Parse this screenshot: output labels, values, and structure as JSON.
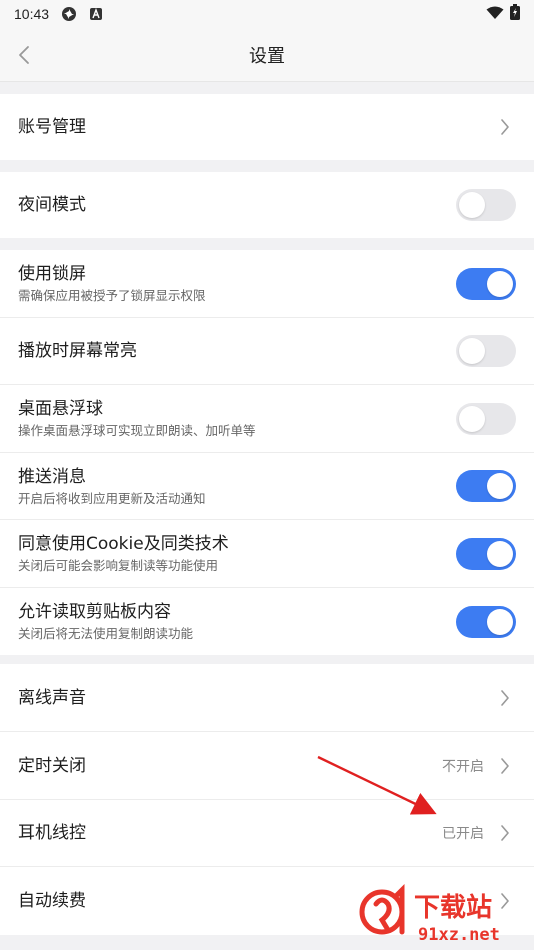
{
  "status_bar": {
    "time": "10:43",
    "icons": [
      "pinwheel-icon",
      "a-badge-icon",
      "wifi-icon",
      "battery-charging-icon"
    ]
  },
  "nav": {
    "title": "设置",
    "back_icon": "chevron-left-icon"
  },
  "sections": [
    {
      "items": [
        {
          "label": "账号管理",
          "control": "chevron"
        }
      ]
    },
    {
      "items": [
        {
          "label": "夜间模式",
          "control": "toggle",
          "on": false
        }
      ]
    },
    {
      "items": [
        {
          "label": "使用锁屏",
          "sub": "需确保应用被授予了锁屏显示权限",
          "control": "toggle",
          "on": true
        },
        {
          "label": "播放时屏幕常亮",
          "control": "toggle",
          "on": false
        },
        {
          "label": "桌面悬浮球",
          "sub": "操作桌面悬浮球可实现立即朗读、加听单等",
          "control": "toggle",
          "on": false
        },
        {
          "label": "推送消息",
          "sub": "开启后将收到应用更新及活动通知",
          "control": "toggle",
          "on": true
        },
        {
          "label": "同意使用Cookie及同类技术",
          "sub": "关闭后可能会影响复制读等功能使用",
          "control": "toggle",
          "on": true
        },
        {
          "label": "允许读取剪贴板内容",
          "sub": "关闭后将无法使用复制朗读功能",
          "control": "toggle",
          "on": true
        }
      ]
    },
    {
      "items": [
        {
          "label": "离线声音",
          "control": "chevron"
        },
        {
          "label": "定时关闭",
          "value": "不开启",
          "control": "chevron"
        },
        {
          "label": "耳机线控",
          "value": "已开启",
          "control": "chevron"
        },
        {
          "label": "自动续费",
          "control": "chevron"
        }
      ]
    }
  ],
  "watermark": {
    "main": "下载站",
    "url": "91xz.net"
  },
  "colors": {
    "accent": "#3d7cf2",
    "toggle_off": "#e7e7ea",
    "background": "#f1f1f3",
    "annotation_arrow": "#e02020",
    "watermark_red": "#e8352b"
  }
}
